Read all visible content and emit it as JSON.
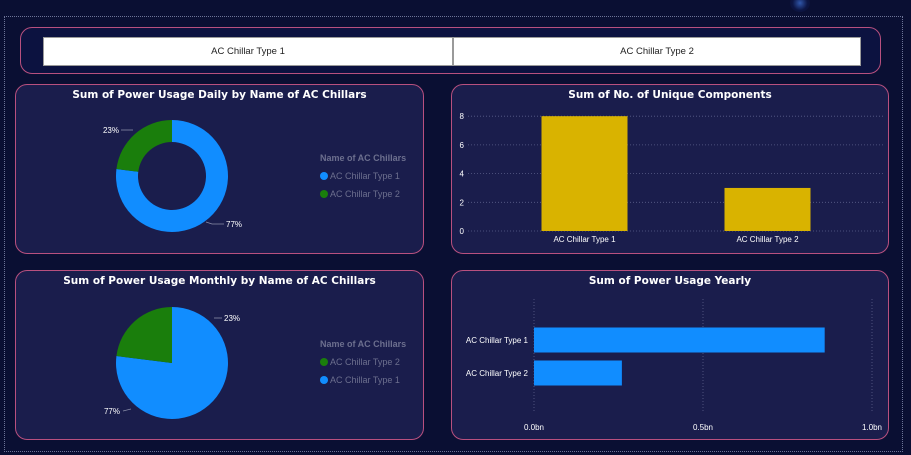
{
  "colors": {
    "type1": "#118dff",
    "type2": "#1a7e0c",
    "bar": "#d9b300"
  },
  "slicer": {
    "items": [
      "AC Chillar Type 1",
      "AC Chillar Type 2"
    ]
  },
  "daily": {
    "title": "Sum of Power Usage Daily by Name of AC Chillars",
    "label_type1": "77%",
    "label_type2": "23%",
    "legend_title": "Name of AC Chillars",
    "legend_items": [
      "AC Chillar Type 1",
      "AC Chillar Type 2"
    ]
  },
  "components": {
    "title": "Sum of No. of Unique Components"
  },
  "monthly": {
    "title": "Sum of Power Usage Monthly by Name of AC Chillars",
    "label_type1": "77%",
    "label_type2": "23%",
    "legend_title": "Name of AC Chillars",
    "legend_items": [
      "AC Chillar Type 2",
      "AC Chillar Type 1"
    ]
  },
  "yearly": {
    "title": "Sum of Power Usage Yearly"
  },
  "chart_data": [
    {
      "type": "pie",
      "variant": "donut",
      "title": "Sum of Power Usage Daily by Name of AC Chillars",
      "categories": [
        "AC Chillar Type 1",
        "AC Chillar Type 2"
      ],
      "values": [
        77,
        23
      ],
      "data_labels": [
        "77%",
        "23%"
      ],
      "legend_title": "Name of AC Chillars",
      "legend_position": "right"
    },
    {
      "type": "bar",
      "title": "Sum of No. of Unique Components",
      "categories": [
        "AC Chillar Type 1",
        "AC Chillar Type 2"
      ],
      "values": [
        8,
        3
      ],
      "yticks": [
        "0",
        "2",
        "4",
        "6",
        "8"
      ],
      "ylim": [
        0,
        8.5
      ],
      "grid": true
    },
    {
      "type": "pie",
      "title": "Sum of Power Usage Monthly by Name of AC Chillars",
      "categories": [
        "AC Chillar Type 1",
        "AC Chillar Type 2"
      ],
      "values": [
        77,
        23
      ],
      "data_labels": [
        "77%",
        "23%"
      ],
      "legend_title": "Name of AC Chillars",
      "legend_position": "right"
    },
    {
      "type": "bar",
      "orientation": "horizontal",
      "title": "Sum of Power Usage Yearly",
      "categories": [
        "AC Chillar Type 1",
        "AC Chillar Type 2"
      ],
      "values": [
        0.86,
        0.26
      ],
      "xticks": [
        "0.0bn",
        "0.5bn",
        "1.0bn"
      ],
      "xlim": [
        0,
        1.0
      ],
      "grid": true
    }
  ]
}
